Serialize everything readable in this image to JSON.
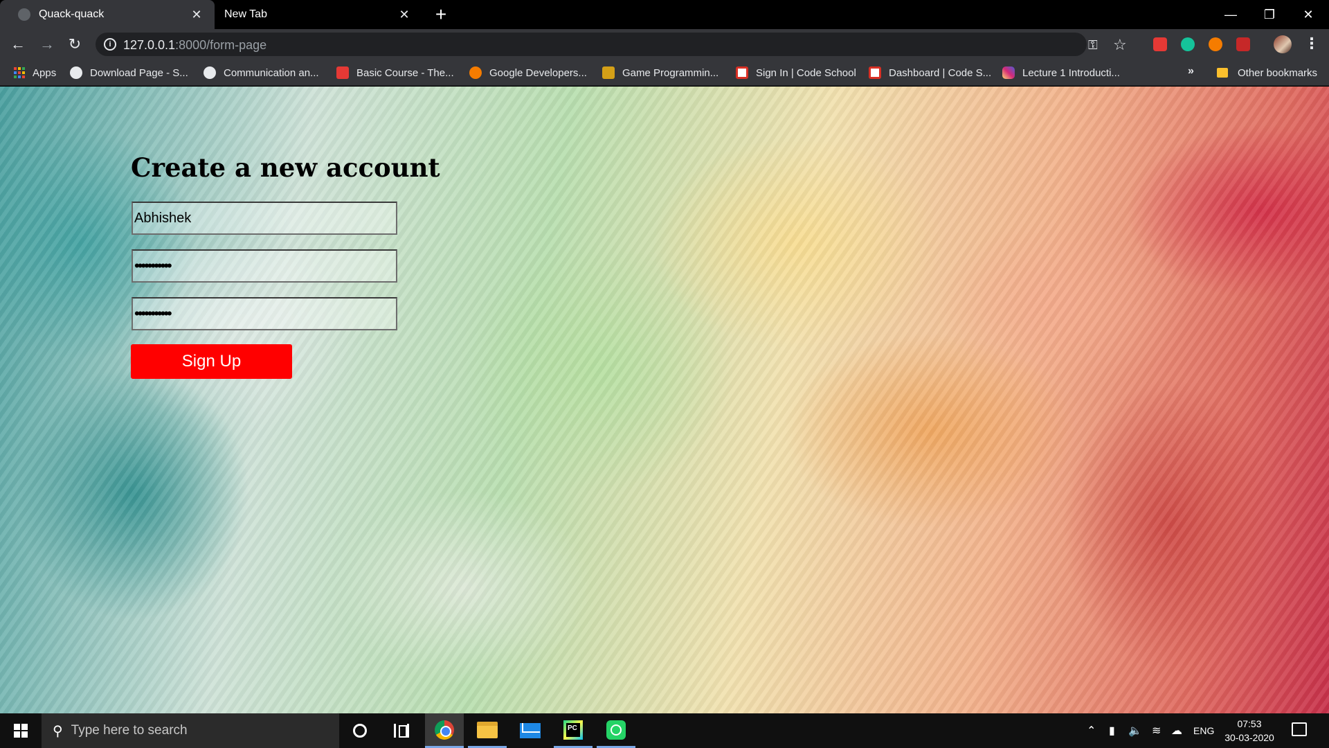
{
  "browser": {
    "tabs": [
      {
        "title": "Quack-quack",
        "active": true
      },
      {
        "title": "New Tab",
        "active": false
      }
    ],
    "close_glyph": "✕",
    "new_tab_glyph": "+",
    "window_controls": {
      "minimize": "—",
      "restore": "❐",
      "close": "✕"
    },
    "address": {
      "host": "127.0.0.1",
      "path": ":8000/form-page"
    },
    "bookmarks": [
      {
        "label": "Apps",
        "icon": "apps-grid-icon"
      },
      {
        "label": "Download Page - S...",
        "icon": "globe-icon"
      },
      {
        "label": "Communication an...",
        "icon": "globe-icon"
      },
      {
        "label": "Basic Course - The...",
        "icon": "red-logo-icon"
      },
      {
        "label": "Google Developers...",
        "icon": "orange-logo-icon"
      },
      {
        "label": "Game Programmin...",
        "icon": "yellow-logo-icon"
      },
      {
        "label": "Sign In | Code School",
        "icon": "gmail-icon"
      },
      {
        "label": "Dashboard | Code S...",
        "icon": "gmail-icon"
      },
      {
        "label": "Lecture 1 Introducti...",
        "icon": "instagram-icon"
      }
    ],
    "bookmarks_overflow": "»",
    "other_bookmarks": "Other bookmarks"
  },
  "form": {
    "title": "Create a new account",
    "username_value": "Abhishek",
    "password_value": "•••••••••••",
    "confirm_password_value": "•••••••••••",
    "submit_label": "Sign Up"
  },
  "taskbar": {
    "search_placeholder": "Type here to search",
    "language": "ENG",
    "time": "07:53",
    "date": "30-03-2020"
  },
  "colors": {
    "signup_button": "#ff0000",
    "browser_chrome": "#35363a",
    "taskbar": "#101010"
  }
}
